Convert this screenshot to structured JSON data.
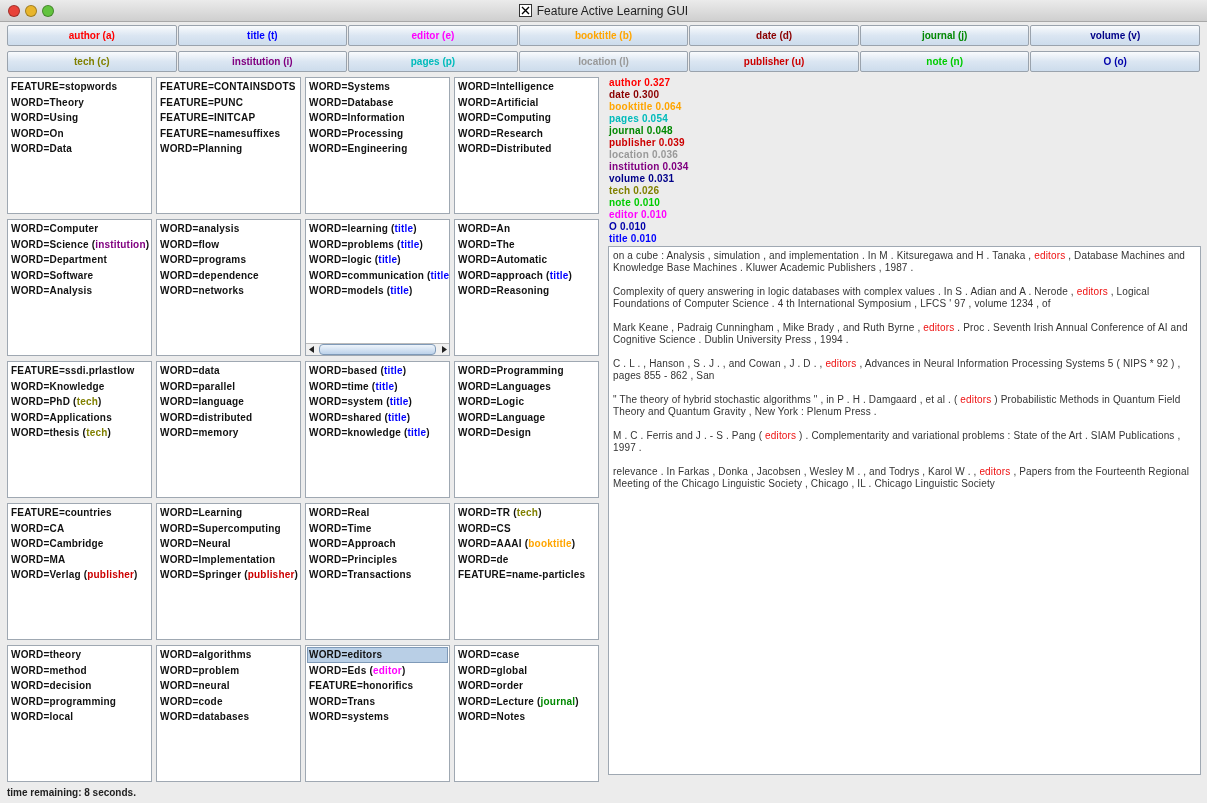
{
  "window": {
    "title": "Feature Active Learning GUI"
  },
  "button_rows": [
    {
      "buttons": [
        {
          "label": "author (a)",
          "color": "#ff0000"
        },
        {
          "label": "title (t)",
          "color": "#0000ff"
        },
        {
          "label": "editor (e)",
          "color": "#ff00ff"
        },
        {
          "label": "booktitle (b)",
          "color": "#ffa500"
        },
        {
          "label": "date (d)",
          "color": "#8b0000"
        },
        {
          "label": "journal (j)",
          "color": "#008800"
        },
        {
          "label": "volume (v)",
          "color": "#000088"
        }
      ]
    },
    {
      "buttons": [
        {
          "label": "tech (c)",
          "color": "#808000"
        },
        {
          "label": "institution (i)",
          "color": "#800080"
        },
        {
          "label": "pages (p)",
          "color": "#00bbbb"
        },
        {
          "label": "location (l)",
          "color": "#999999"
        },
        {
          "label": "publisher (u)",
          "color": "#cc0000"
        },
        {
          "label": "note (n)",
          "color": "#00cc00"
        },
        {
          "label": "O (o)",
          "color": "#0000aa"
        }
      ]
    }
  ],
  "panels": [
    {
      "items": [
        {
          "text": "FEATURE=stopwords",
          "selected": false
        },
        {
          "text": "WORD=Theory",
          "selected": false
        },
        {
          "text": "WORD=Using",
          "selected": false
        },
        {
          "text": "WORD=On",
          "selected": false
        },
        {
          "text": "WORD=Data",
          "selected": false
        }
      ]
    },
    {
      "items": [
        {
          "text": "FEATURE=CONTAINSDOTS",
          "selected": false
        },
        {
          "text": "FEATURE=PUNC",
          "selected": false
        },
        {
          "text": "FEATURE=INITCAP",
          "selected": false
        },
        {
          "text": "FEATURE=namesuffixes",
          "selected": false
        },
        {
          "text": "WORD=Planning",
          "selected": false
        }
      ]
    },
    {
      "items": [
        {
          "text": "WORD=Systems",
          "selected": false
        },
        {
          "text": "WORD=Database",
          "selected": false
        },
        {
          "text": "WORD=Information",
          "selected": false
        },
        {
          "text": "WORD=Processing",
          "selected": false
        },
        {
          "text": "WORD=Engineering",
          "selected": false
        }
      ]
    },
    {
      "items": [
        {
          "text": "WORD=Intelligence",
          "selected": false
        },
        {
          "text": "WORD=Artificial",
          "selected": false
        },
        {
          "text": "WORD=Computing",
          "selected": false
        },
        {
          "text": "WORD=Research",
          "selected": false
        },
        {
          "text": "WORD=Distributed",
          "selected": false
        }
      ]
    },
    {
      "items": [
        {
          "text": "WORD=Computer",
          "selected": false
        },
        {
          "text": "WORD=Science",
          "tag": "(institution)",
          "color": "#800080",
          "selected": false
        },
        {
          "text": "WORD=Department",
          "selected": false
        },
        {
          "text": "WORD=Software",
          "selected": false
        },
        {
          "text": "WORD=Analysis",
          "selected": false
        }
      ]
    },
    {
      "items": [
        {
          "text": "WORD=analysis",
          "selected": false
        },
        {
          "text": "WORD=flow",
          "selected": false
        },
        {
          "text": "WORD=programs",
          "selected": false
        },
        {
          "text": "WORD=dependence",
          "selected": false
        },
        {
          "text": "WORD=networks",
          "selected": false
        }
      ]
    },
    {
      "h_scroll": true,
      "items": [
        {
          "text": "WORD=learning",
          "tag": "(title)",
          "color": "#0000ff",
          "selected": false
        },
        {
          "text": "WORD=problems",
          "tag": "(title)",
          "color": "#0000ff",
          "selected": false
        },
        {
          "text": "WORD=logic",
          "tag": "(title)",
          "color": "#0000ff",
          "selected": false
        },
        {
          "text": "WORD=communication",
          "tag": "(title",
          "color": "#0000ff",
          "selected": false
        },
        {
          "text": "WORD=models",
          "tag": "(title)",
          "color": "#0000ff",
          "selected": false
        }
      ]
    },
    {
      "items": [
        {
          "text": "WORD=An",
          "selected": false
        },
        {
          "text": "WORD=The",
          "selected": false
        },
        {
          "text": "WORD=Automatic",
          "selected": false
        },
        {
          "text": "WORD=approach",
          "tag": "(title)",
          "color": "#0000ff",
          "selected": false
        },
        {
          "text": "WORD=Reasoning",
          "selected": false
        }
      ]
    },
    {
      "items": [
        {
          "text": "FEATURE=ssdi.prlastlow",
          "selected": false
        },
        {
          "text": "WORD=Knowledge",
          "selected": false
        },
        {
          "text": "WORD=PhD",
          "tag": "(tech)",
          "color": "#808000",
          "selected": false
        },
        {
          "text": "WORD=Applications",
          "selected": false
        },
        {
          "text": "WORD=thesis",
          "tag": "(tech)",
          "color": "#808000",
          "selected": false
        }
      ]
    },
    {
      "items": [
        {
          "text": "WORD=data",
          "selected": false
        },
        {
          "text": "WORD=parallel",
          "selected": false
        },
        {
          "text": "WORD=language",
          "selected": false
        },
        {
          "text": "WORD=distributed",
          "selected": false
        },
        {
          "text": "WORD=memory",
          "selected": false
        }
      ]
    },
    {
      "items": [
        {
          "text": "WORD=based",
          "tag": "(title)",
          "color": "#0000ff",
          "selected": false
        },
        {
          "text": "WORD=time",
          "tag": "(title)",
          "color": "#0000ff",
          "selected": false
        },
        {
          "text": "WORD=system",
          "tag": "(title)",
          "color": "#0000ff",
          "selected": false
        },
        {
          "text": "WORD=shared",
          "tag": "(title)",
          "color": "#0000ff",
          "selected": false
        },
        {
          "text": "WORD=knowledge",
          "tag": "(title)",
          "color": "#0000ff",
          "selected": false
        }
      ]
    },
    {
      "items": [
        {
          "text": "WORD=Programming",
          "selected": false
        },
        {
          "text": "WORD=Languages",
          "selected": false
        },
        {
          "text": "WORD=Logic",
          "selected": false
        },
        {
          "text": "WORD=Language",
          "selected": false
        },
        {
          "text": "WORD=Design",
          "selected": false
        }
      ]
    },
    {
      "items": [
        {
          "text": "FEATURE=countries",
          "selected": false
        },
        {
          "text": "WORD=CA",
          "selected": false
        },
        {
          "text": "WORD=Cambridge",
          "selected": false
        },
        {
          "text": "WORD=MA",
          "selected": false
        },
        {
          "text": "WORD=Verlag",
          "tag": "(publisher)",
          "color": "#cc0000",
          "selected": false
        }
      ]
    },
    {
      "items": [
        {
          "text": "WORD=Learning",
          "selected": false
        },
        {
          "text": "WORD=Supercomputing",
          "selected": false
        },
        {
          "text": "WORD=Neural",
          "selected": false
        },
        {
          "text": "WORD=Implementation",
          "selected": false
        },
        {
          "text": "WORD=Springer",
          "tag": "(publisher)",
          "color": "#cc0000",
          "selected": false
        }
      ]
    },
    {
      "items": [
        {
          "text": "WORD=Real",
          "selected": false
        },
        {
          "text": "WORD=Time",
          "selected": false
        },
        {
          "text": "WORD=Approach",
          "selected": false
        },
        {
          "text": "WORD=Principles",
          "selected": false
        },
        {
          "text": "WORD=Transactions",
          "selected": false
        }
      ]
    },
    {
      "items": [
        {
          "text": "WORD=TR",
          "tag": "(tech)",
          "color": "#808000",
          "selected": false
        },
        {
          "text": "WORD=CS",
          "selected": false
        },
        {
          "text": "WORD=AAAI",
          "tag": "(booktitle)",
          "color": "#ffa500",
          "selected": false
        },
        {
          "text": "WORD=de",
          "selected": false
        },
        {
          "text": "FEATURE=name-particles",
          "selected": false
        }
      ]
    },
    {
      "items": [
        {
          "text": "WORD=theory",
          "selected": false
        },
        {
          "text": "WORD=method",
          "selected": false
        },
        {
          "text": "WORD=decision",
          "selected": false
        },
        {
          "text": "WORD=programming",
          "selected": false
        },
        {
          "text": "WORD=local",
          "selected": false
        }
      ]
    },
    {
      "items": [
        {
          "text": "WORD=algorithms",
          "selected": false
        },
        {
          "text": "WORD=problem",
          "selected": false
        },
        {
          "text": "WORD=neural",
          "selected": false
        },
        {
          "text": "WORD=code",
          "selected": false
        },
        {
          "text": "WORD=databases",
          "selected": false
        }
      ]
    },
    {
      "items": [
        {
          "text": "WORD=editors",
          "selected": true
        },
        {
          "text": "WORD=Eds",
          "tag": "(editor)",
          "color": "#ff00ff",
          "selected": false
        },
        {
          "text": "FEATURE=honorifics",
          "selected": false
        },
        {
          "text": "WORD=Trans",
          "selected": false
        },
        {
          "text": "WORD=systems",
          "selected": false
        }
      ]
    },
    {
      "items": [
        {
          "text": "WORD=case",
          "selected": false
        },
        {
          "text": "WORD=global",
          "selected": false
        },
        {
          "text": "WORD=order",
          "selected": false
        },
        {
          "text": "WORD=Lecture",
          "tag": "(journal)",
          "color": "#008800",
          "selected": false
        },
        {
          "text": "WORD=Notes",
          "selected": false
        }
      ]
    }
  ],
  "scores": [
    {
      "text": "author 0.327",
      "color": "#ff0000"
    },
    {
      "text": "date 0.300",
      "color": "#8b0000"
    },
    {
      "text": "booktitle 0.064",
      "color": "#ffa500"
    },
    {
      "text": "pages 0.054",
      "color": "#00bbbb"
    },
    {
      "text": "journal 0.048",
      "color": "#008800"
    },
    {
      "text": "publisher 0.039",
      "color": "#cc0000"
    },
    {
      "text": "location 0.036",
      "color": "#999999"
    },
    {
      "text": "institution 0.034",
      "color": "#800080"
    },
    {
      "text": "volume 0.031",
      "color": "#000088"
    },
    {
      "text": "tech 0.026",
      "color": "#808000"
    },
    {
      "text": "note 0.010",
      "color": "#00cc00"
    },
    {
      "text": "editor 0.010",
      "color": "#ff00ff"
    },
    {
      "text": "O 0.010",
      "color": "#0000aa"
    },
    {
      "text": "title 0.010",
      "color": "#0000ff"
    }
  ],
  "examples": [
    {
      "segments": [
        {
          "text": "on a cube : Analysis , simulation , and implementation . In M . Kitsuregawa and H . Tanaka , ",
          "tagged": false
        },
        {
          "text": "editors",
          "tagged": true
        },
        {
          "text": " , Database Machines and Knowledge Base Machines . Kluwer Academic Publishers , 1987 .",
          "tagged": false
        }
      ]
    },
    {
      "segments": [
        {
          "text": "Complexity of query answering in logic databases with complex values . In S . Adian and A . Nerode , ",
          "tagged": false
        },
        {
          "text": "editors",
          "tagged": true
        },
        {
          "text": " , Logical Foundations of Computer Science . 4 th International Symposium , LFCS ' 97 , volume 1234 , of",
          "tagged": false
        }
      ]
    },
    {
      "segments": [
        {
          "text": "Mark Keane , Padraig Cunningham , Mike Brady , and Ruth Byrne , ",
          "tagged": false
        },
        {
          "text": "editors",
          "tagged": true
        },
        {
          "text": " . Proc . Seventh Irish Annual Conference of AI and Cognitive Science . Dublin University Press , 1994 .",
          "tagged": false
        }
      ]
    },
    {
      "segments": [
        {
          "text": "C . L . , Hanson , S . J . , and Cowan , J . D . , ",
          "tagged": false
        },
        {
          "text": "editors",
          "tagged": true
        },
        {
          "text": " , Advances in Neural Information Processing Systems 5 ( NIPS * 92 ) , pages 855 - 862 , San",
          "tagged": false
        }
      ]
    },
    {
      "segments": [
        {
          "text": "\" The theory of hybrid stochastic algorithms \" , in P . H . Damgaard , et al . ( ",
          "tagged": false
        },
        {
          "text": "editors",
          "tagged": true
        },
        {
          "text": " ) Probabilistic Methods in Quantum Field Theory and Quantum Gravity , New York : Plenum Press .",
          "tagged": false
        }
      ]
    },
    {
      "segments": [
        {
          "text": "M . C . Ferris and J . - S . Pang ( ",
          "tagged": false
        },
        {
          "text": "editors",
          "tagged": true
        },
        {
          "text": " ) . Complementarity and variational problems : State of the Art . SIAM Publications , 1997 .",
          "tagged": false
        }
      ]
    },
    {
      "segments": [
        {
          "text": "relevance . In Farkas , Donka , Jacobsen , Wesley M . , and Todrys , Karol W . , ",
          "tagged": false
        },
        {
          "text": "editors",
          "tagged": true
        },
        {
          "text": " , Papers from the Fourteenth Regional Meeting of the Chicago Linguistic Society , Chicago , IL . Chicago Linguistic Society",
          "tagged": false
        }
      ]
    }
  ],
  "status_bar": {
    "text": "time remaining: 8 seconds."
  }
}
